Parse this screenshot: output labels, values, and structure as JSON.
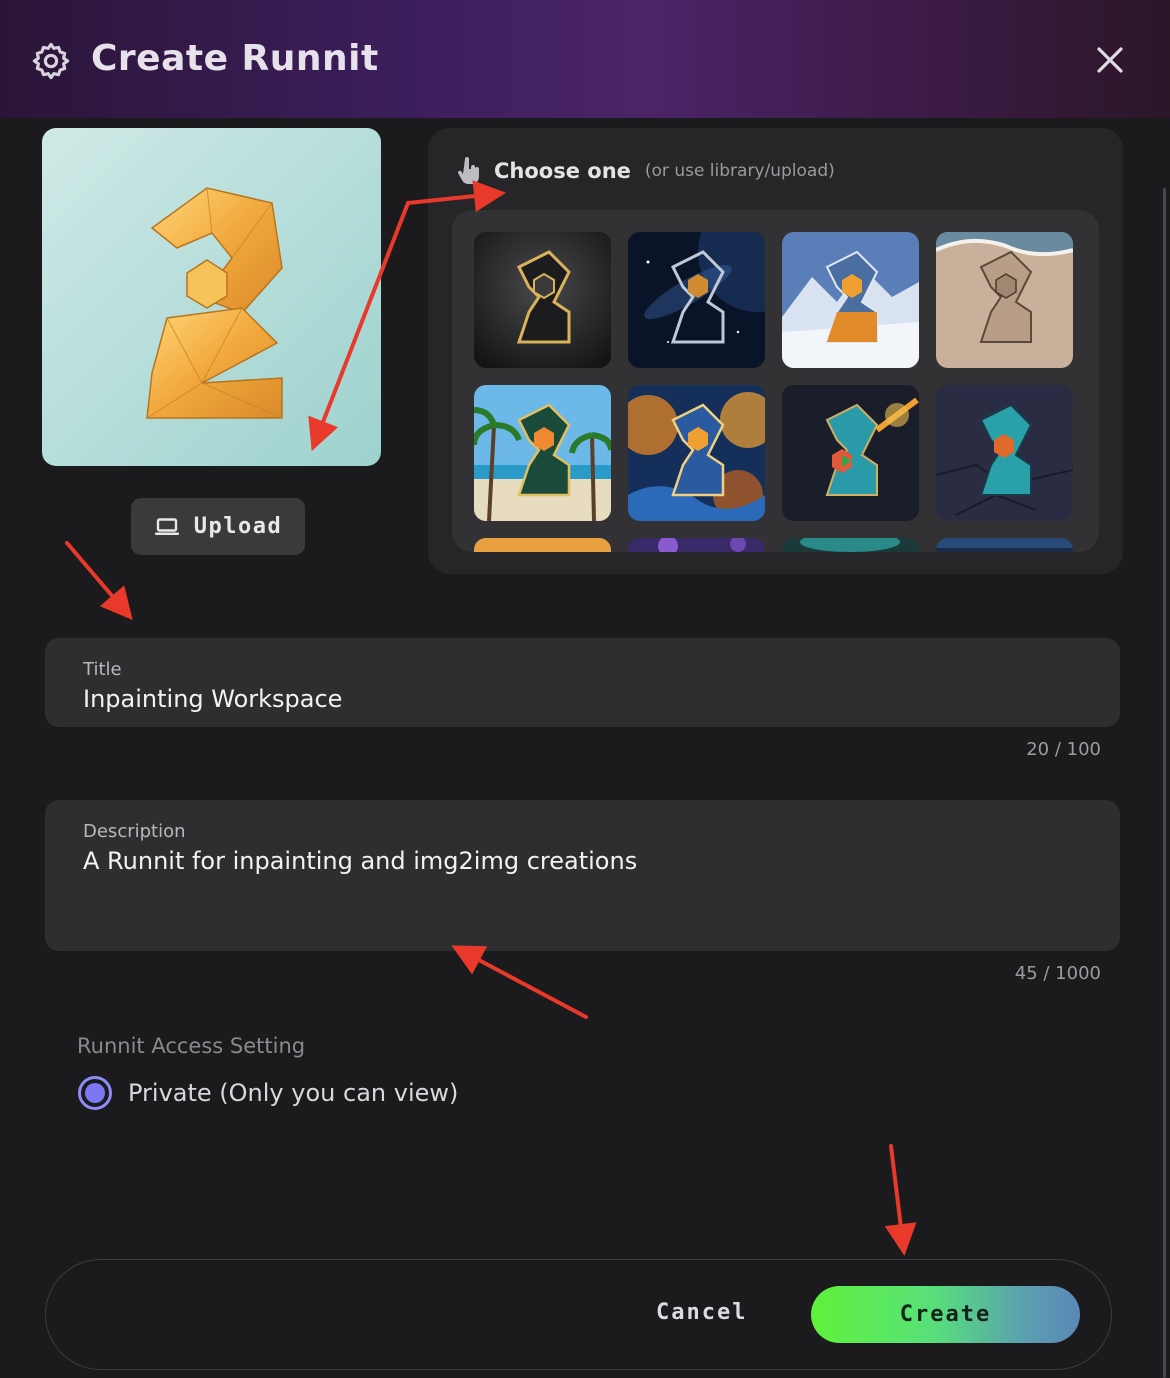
{
  "header": {
    "title": "Create Runnit"
  },
  "upload": {
    "label": "Upload"
  },
  "chooser": {
    "label": "Choose one",
    "sublabel": "(or use library/upload)"
  },
  "thumbnails": [
    "dark-gold-logo",
    "space-logo",
    "snowy-mountain-logo",
    "sand-beach-logo",
    "tropical-palm-logo",
    "fire-water-logo",
    "teal-spark-logo",
    "teal-stone-logo"
  ],
  "title_field": {
    "label": "Title",
    "value": "Inpainting Workspace",
    "counter": "20 / 100"
  },
  "description_field": {
    "label": "Description",
    "value": "A Runnit for inpainting and img2img creations",
    "counter": "45 / 1000"
  },
  "access": {
    "label": "Runnit Access Setting",
    "option": "Private (Only you can view)",
    "selected": true
  },
  "footer": {
    "cancel_label": "Cancel",
    "create_label": "Create"
  },
  "colors": {
    "accent": "#7b78f2",
    "create_gradient_start": "#5ef23a",
    "create_gradient_end": "#5a88b8",
    "annotation": "#e8392b"
  }
}
